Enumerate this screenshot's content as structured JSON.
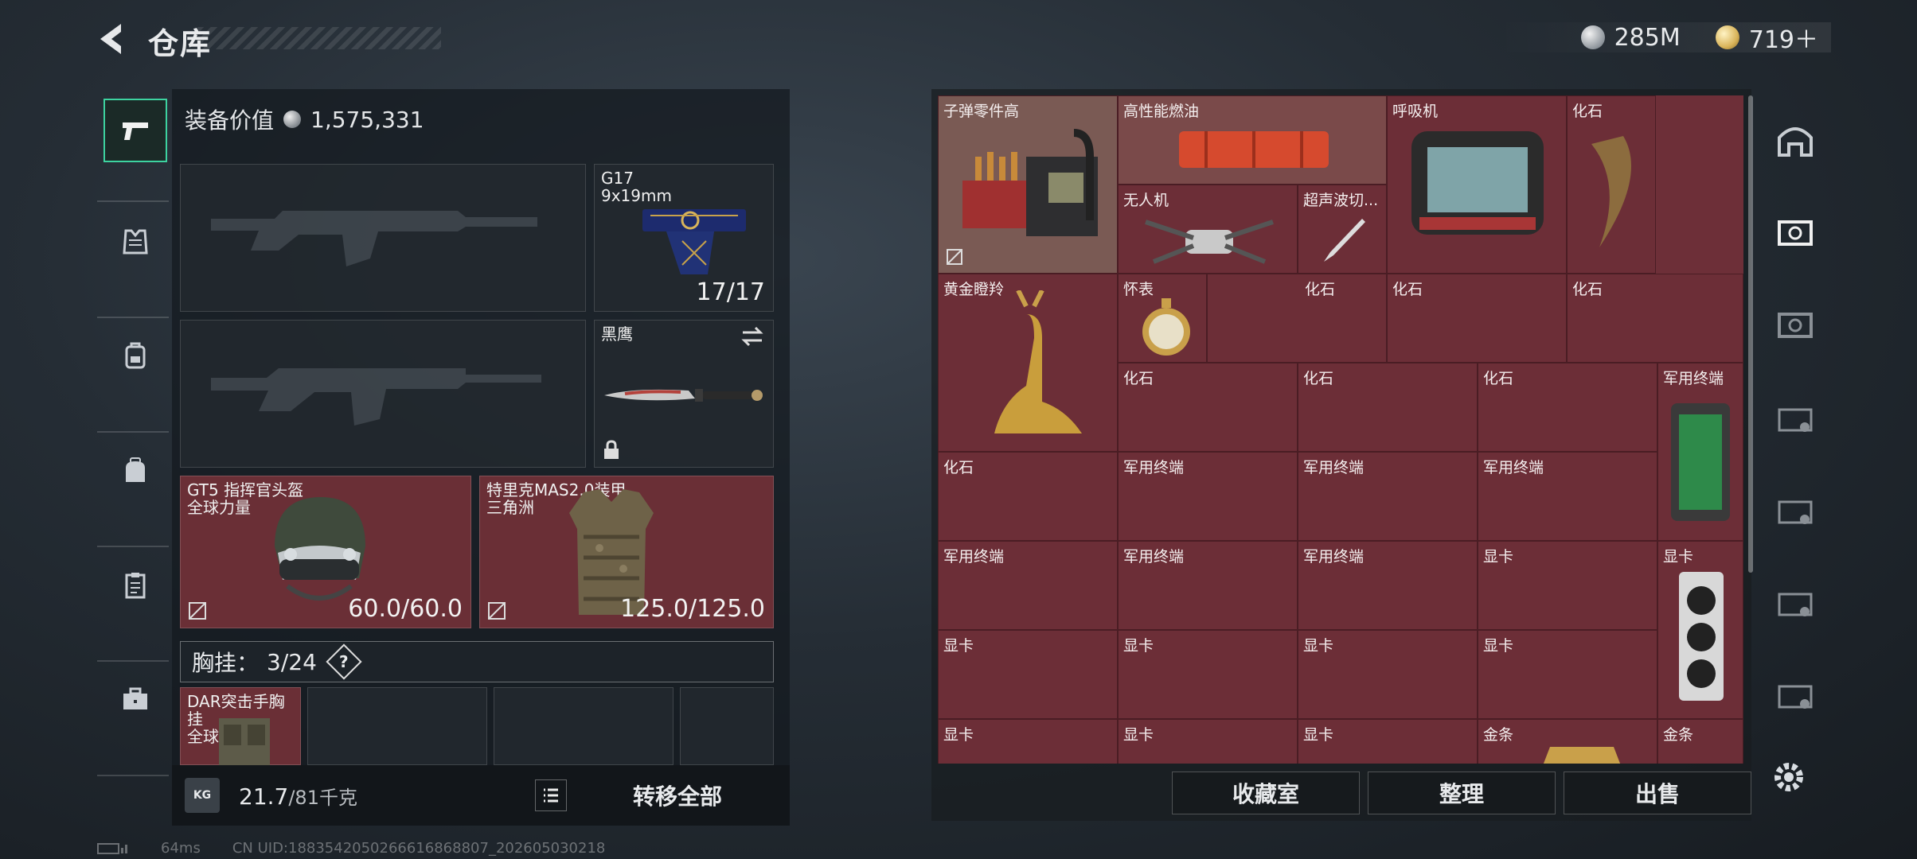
{
  "header": {
    "title": "仓库",
    "currency_silver": "285M",
    "currency_gold": "719＋"
  },
  "left_tabs": [
    {
      "name": "weapon",
      "icon": "pistol-icon"
    },
    {
      "name": "armor",
      "icon": "vest-icon"
    },
    {
      "name": "backpack-a",
      "icon": "backpack-icon"
    },
    {
      "name": "backpack-b",
      "icon": "bag-icon"
    },
    {
      "name": "clipboard",
      "icon": "clipboard-icon"
    },
    {
      "name": "case",
      "icon": "briefcase-icon"
    }
  ],
  "equipment": {
    "value_label": "装备价值",
    "value": "1,575,331",
    "pistol": {
      "name": "G17",
      "ammo": "9x19mm",
      "count": "17/17"
    },
    "melee": {
      "name": "黑鹰"
    },
    "helmet": {
      "name": "GT5 指挥官头盔",
      "sub": "全球力量",
      "durability": "60.0/60.0"
    },
    "armor": {
      "name": "特里克MAS2.0装甲",
      "sub": "三角洲",
      "durability": "125.0/125.0"
    },
    "chest": {
      "label": "胸挂：",
      "capacity": "3/24",
      "help": "?"
    },
    "chest_item": {
      "name": "DAR突击手胸挂",
      "sub": "全球力量"
    }
  },
  "bottom": {
    "weight_icon": "KG",
    "weight": "21.7",
    "weight_max": "/81千克",
    "transfer_all": "转移全部"
  },
  "stash_items": [
    {
      "label": "子弹零件高"
    },
    {
      "label": "高性能燃油"
    },
    {
      "label": "呼吸机"
    },
    {
      "label": "化石"
    },
    {
      "label": "无人机"
    },
    {
      "label": "超声波切..."
    },
    {
      "label": "黄金瞪羚"
    },
    {
      "label": "怀表"
    },
    {
      "label": "化石"
    },
    {
      "label": "化石"
    },
    {
      "label": "化石"
    },
    {
      "label": "化石"
    },
    {
      "label": "化石"
    },
    {
      "label": "军用终端"
    },
    {
      "label": "化石"
    },
    {
      "label": "军用终端"
    },
    {
      "label": "军用终端"
    },
    {
      "label": "军用终端"
    },
    {
      "label": "军用终端"
    },
    {
      "label": "军用终端"
    },
    {
      "label": "军用终端"
    },
    {
      "label": "显卡"
    },
    {
      "label": "显卡"
    },
    {
      "label": "显卡"
    },
    {
      "label": "显卡"
    },
    {
      "label": "显卡"
    },
    {
      "label": "显卡"
    },
    {
      "label": "显卡"
    },
    {
      "label": "显卡"
    },
    {
      "label": "显卡"
    },
    {
      "label": "金条"
    },
    {
      "label": "金条"
    }
  ],
  "stash_buttons": {
    "collection": "收藏室",
    "organize": "整理",
    "sell": "出售"
  },
  "status": {
    "ping": "64ms",
    "uid": "CN UID:1883542050266616868807_202605030218"
  }
}
